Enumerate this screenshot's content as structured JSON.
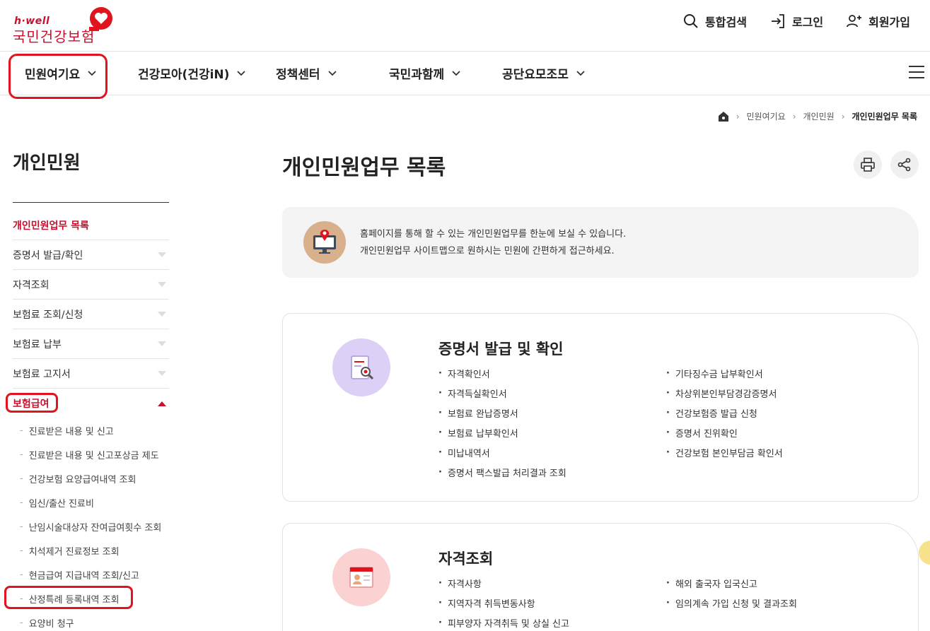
{
  "header": {
    "logo_en": "h·well",
    "logo_ko": "국민건강보험",
    "util": [
      {
        "label": "통합검색",
        "icon": "search-icon"
      },
      {
        "label": "로그인",
        "icon": "login-icon"
      },
      {
        "label": "회원가입",
        "icon": "add-user-icon"
      }
    ]
  },
  "gnb": {
    "menus": [
      "민원여기요",
      "건강모아(건강iN)",
      "정책센터",
      "국민과함께",
      "공단요모조모"
    ]
  },
  "breadcrumb": [
    "민원여기요",
    "개인민원",
    "개인민원업무 목록"
  ],
  "sidebar": {
    "title": "개인민원",
    "items": [
      {
        "label": "개인민원업무 목록"
      },
      {
        "label": "증명서 발급/확인"
      },
      {
        "label": "자격조회"
      },
      {
        "label": "보험료 조회/신청"
      },
      {
        "label": "보험료 납부"
      },
      {
        "label": "보험료 고지서"
      },
      {
        "label": "보험급여"
      }
    ],
    "subitems": [
      "진료받은 내용 및 신고",
      "진료받은 내용 및 신고포상금 제도",
      "건강보험 요양급여내역 조회",
      "임신/출산 진료비",
      "난임시술대상자 잔여급여횟수 조회",
      "치석제거 진료정보 조회",
      "현금급여 지급내역 조회/신고",
      "산정특례 등록내역 조회",
      "요양비 청구"
    ]
  },
  "main": {
    "title": "개인민원업무 목록",
    "notice_line1": "홈페이지를 통해 할 수 있는 개인민원업무를 한눈에 보실 수 있습니다.",
    "notice_line2": "개인민원업무 사이트맵으로 원하시는 민원에 간편하게 접근하세요.",
    "cards": [
      {
        "title": "증명서 발급 및 확인",
        "items": [
          "자격확인서",
          "기타징수금 납부확인서",
          "자격득실확인서",
          "차상위본인부담경감증명서",
          "보험료 완납증명서",
          "건강보험증 발급 신청",
          "보험료 납부확인서",
          "증명서 진위확인",
          "미납내역서",
          "건강보험 본인부담금 확인서",
          "증명서 팩스발급 처리결과 조회"
        ]
      },
      {
        "title": "자격조회",
        "items": [
          "자격사항",
          "해외 출국자 입국신고",
          "지역자격 취득변동사항",
          "임의계속 가입 신청 및 결과조회",
          "피부양자 자격취득 및 상실 신고"
        ]
      }
    ]
  },
  "colors": {
    "brand": "#c8102e",
    "highlight": "#e0141e"
  }
}
